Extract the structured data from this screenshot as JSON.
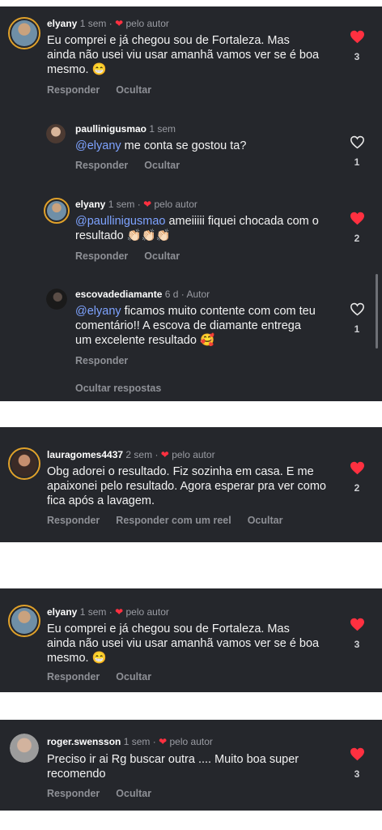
{
  "pelo_autor": "pelo autor",
  "actions": {
    "reply": "Responder",
    "hide": "Ocultar",
    "reply_reel": "Responder com um reel",
    "hide_replies": "Ocultar respostas"
  },
  "c1": {
    "user": "elyany",
    "time": "1 sem",
    "dot": "·",
    "text": "Eu comprei e já chegou sou de Fortaleza.  Mas ainda não usei viu usar amanhã vamos ver se é boa mesmo. 😁",
    "likes": "3"
  },
  "r1": {
    "user": "paullinigusmao",
    "time": "1 sem",
    "mention": "@elyany",
    "text": " me conta se gostou ta?",
    "likes": "1"
  },
  "r2": {
    "user": "elyany",
    "time": "1 sem",
    "mention": "@paullinigusmao",
    "text": " ameiiiii fiquei chocada com o resultado 👏🏻👏🏻👏🏻",
    "likes": "2"
  },
  "r3": {
    "user": "escovadediamante",
    "time": "6 d",
    "tag": "Autor",
    "mention": "@elyany",
    "text": " ficamos muito contente com com teu comentário!! A escova de diamante entrega um excelente resultado 🥰",
    "likes": "1"
  },
  "c2": {
    "user": "lauragomes4437",
    "time": "2 sem",
    "text": "Obg adorei o resultado.  Fiz sozinha em casa. E me apaixonei pelo resultado. Agora esperar pra ver como fica após a lavagem.",
    "likes": "2"
  },
  "c3": {
    "user": "elyany",
    "time": "1 sem",
    "text": "Eu comprei e já chegou sou de Fortaleza.  Mas ainda não usei viu usar amanhã vamos ver se é boa mesmo. 😁",
    "likes": "3"
  },
  "c4": {
    "user": "roger.swensson",
    "time": "1 sem",
    "text": "Preciso ir ai Rg buscar outra .... Muito boa super recomendo",
    "likes": "3"
  },
  "colors": {
    "card": "#25272c",
    "heart": "#ff3040",
    "mention": "#7ea3ff",
    "ring": "#e0a12a"
  }
}
